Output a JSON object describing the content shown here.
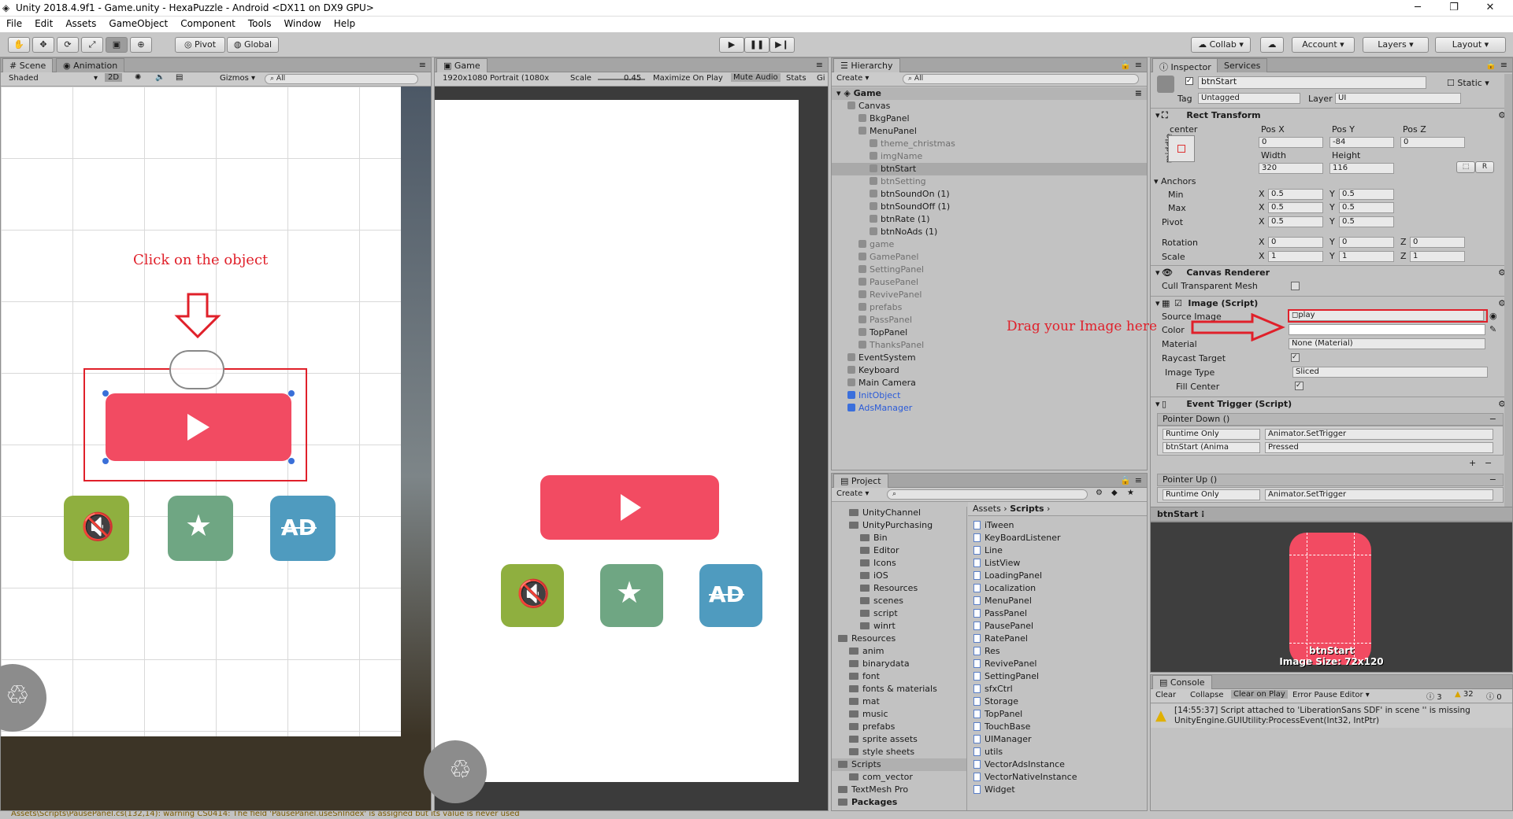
{
  "window": {
    "title": "Unity 2018.4.9f1 - Game.unity - HexaPuzzle - Android <DX11 on DX9 GPU>"
  },
  "menu": [
    "File",
    "Edit",
    "Assets",
    "GameObject",
    "Component",
    "Tools",
    "Window",
    "Help"
  ],
  "toolbar": {
    "pivot": "Pivot",
    "global": "Global",
    "collab": "Collab ▾",
    "account": "Account",
    "layers": "Layers",
    "layout": "Layout"
  },
  "scene": {
    "tab_scene": "Scene",
    "tab_animation": "Animation",
    "shaded": "Shaded",
    "mode_2d": "2D",
    "gizmos": "Gizmos ▾",
    "search": "All",
    "annotation": "Click on the object"
  },
  "game": {
    "tab": "Game",
    "resolution": "1920x1080 Portrait (1080x",
    "scale_label": "Scale",
    "scale_value": "0.45",
    "maximize": "Maximize On Play",
    "mute": "Mute Audio",
    "stats": "Stats",
    "gizmos": "Gi"
  },
  "hierarchy": {
    "tab": "Hierarchy",
    "create": "Create ▾",
    "search": "All",
    "scene": "Game",
    "items": [
      {
        "label": "Canvas",
        "depth": 1,
        "style": "normal"
      },
      {
        "label": "BkgPanel",
        "depth": 2,
        "style": "normal"
      },
      {
        "label": "MenuPanel",
        "depth": 2,
        "style": "normal"
      },
      {
        "label": "theme_christmas",
        "depth": 3,
        "style": "grey"
      },
      {
        "label": "imgName",
        "depth": 3,
        "style": "grey"
      },
      {
        "label": "btnStart",
        "depth": 3,
        "style": "selected"
      },
      {
        "label": "btnSetting",
        "depth": 3,
        "style": "grey"
      },
      {
        "label": "btnSoundOn (1)",
        "depth": 3,
        "style": "normal"
      },
      {
        "label": "btnSoundOff (1)",
        "depth": 3,
        "style": "normal"
      },
      {
        "label": "btnRate (1)",
        "depth": 3,
        "style": "normal"
      },
      {
        "label": "btnNoAds (1)",
        "depth": 3,
        "style": "normal"
      },
      {
        "label": "game",
        "depth": 2,
        "style": "grey"
      },
      {
        "label": "GamePanel",
        "depth": 2,
        "style": "grey"
      },
      {
        "label": "SettingPanel",
        "depth": 2,
        "style": "grey"
      },
      {
        "label": "PausePanel",
        "depth": 2,
        "style": "grey"
      },
      {
        "label": "RevivePanel",
        "depth": 2,
        "style": "grey"
      },
      {
        "label": "prefabs",
        "depth": 2,
        "style": "grey"
      },
      {
        "label": "PassPanel",
        "depth": 2,
        "style": "grey"
      },
      {
        "label": "TopPanel",
        "depth": 2,
        "style": "normal"
      },
      {
        "label": "ThanksPanel",
        "depth": 2,
        "style": "grey"
      },
      {
        "label": "EventSystem",
        "depth": 1,
        "style": "normal"
      },
      {
        "label": "Keyboard",
        "depth": 1,
        "style": "normal"
      },
      {
        "label": "Main Camera",
        "depth": 1,
        "style": "normal"
      },
      {
        "label": "InitObject",
        "depth": 1,
        "style": "blue"
      },
      {
        "label": "AdsManager",
        "depth": 1,
        "style": "blue"
      }
    ]
  },
  "project": {
    "tab": "Project",
    "create": "Create ▾",
    "breadcrumb_root": "Assets",
    "breadcrumb_leaf": "Scripts",
    "folders": [
      {
        "label": "UnityChannel",
        "depth": 1
      },
      {
        "label": "UnityPurchasing",
        "depth": 1
      },
      {
        "label": "Bin",
        "depth": 2
      },
      {
        "label": "Editor",
        "depth": 2
      },
      {
        "label": "Icons",
        "depth": 2
      },
      {
        "label": "iOS",
        "depth": 2
      },
      {
        "label": "Resources",
        "depth": 2
      },
      {
        "label": "scenes",
        "depth": 2
      },
      {
        "label": "script",
        "depth": 2
      },
      {
        "label": "winrt",
        "depth": 2
      },
      {
        "label": "Resources",
        "depth": 0
      },
      {
        "label": "anim",
        "depth": 1
      },
      {
        "label": "binarydata",
        "depth": 1
      },
      {
        "label": "font",
        "depth": 1
      },
      {
        "label": "fonts & materials",
        "depth": 1
      },
      {
        "label": "mat",
        "depth": 1
      },
      {
        "label": "music",
        "depth": 1
      },
      {
        "label": "prefabs",
        "depth": 1
      },
      {
        "label": "sprite assets",
        "depth": 1
      },
      {
        "label": "style sheets",
        "depth": 1
      },
      {
        "label": "Scripts",
        "depth": 0
      },
      {
        "label": "com_vector",
        "depth": 1
      },
      {
        "label": "TextMesh Pro",
        "depth": 0
      },
      {
        "label": "Packages",
        "depth": -1
      }
    ],
    "scripts": [
      "iTween",
      "KeyBoardListener",
      "Line",
      "ListView",
      "LoadingPanel",
      "Localization",
      "MenuPanel",
      "PassPanel",
      "PausePanel",
      "RatePanel",
      "Res",
      "RevivePanel",
      "SettingPanel",
      "sfxCtrl",
      "Storage",
      "TopPanel",
      "TouchBase",
      "UIManager",
      "utils",
      "VectorAdsInstance",
      "VectorNativeInstance",
      "Widget"
    ]
  },
  "inspector": {
    "tab": "Inspector",
    "tab2": "Services",
    "name": "btnStart",
    "static": "Static",
    "tag_label": "Tag",
    "tag": "Untagged",
    "layer_label": "Layer",
    "layer": "UI",
    "rect": {
      "title": "Rect Transform",
      "anchor_h": "center",
      "anchor_v": "middle",
      "posx_l": "Pos X",
      "posy_l": "Pos Y",
      "posz_l": "Pos Z",
      "posx": "0",
      "posy": "-84",
      "posz": "0",
      "width_l": "Width",
      "height_l": "Height",
      "width": "320",
      "height": "116",
      "anchors": "Anchors",
      "min": "Min",
      "max": "Max",
      "pivot": "Pivot",
      "min_x": "0.5",
      "min_y": "0.5",
      "max_x": "0.5",
      "max_y": "0.5",
      "pivot_x": "0.5",
      "pivot_y": "0.5",
      "rotation": "Rotation",
      "rot_x": "0",
      "rot_y": "0",
      "rot_z": "0",
      "scale": "Scale",
      "sc_x": "1",
      "sc_y": "1",
      "sc_z": "1",
      "x": "X",
      "y": "Y",
      "z": "Z",
      "r": "R"
    },
    "canvas_renderer": {
      "title": "Canvas Renderer",
      "cull": "Cull Transparent Mesh"
    },
    "image": {
      "title": "Image (Script)",
      "source_label": "Source Image",
      "source": "play",
      "color_label": "Color",
      "material_label": "Material",
      "material": "None (Material)",
      "raycast": "Raycast Target",
      "image_type_label": "Image Type",
      "image_type": "Sliced",
      "fill_center": "Fill Center"
    },
    "event": {
      "title": "Event Trigger (Script)",
      "pointer_down": "Pointer Down ()",
      "runtime": "Runtime Only",
      "function": "Animator.SetTrigger",
      "object": "btnStart (Anima",
      "arg": "Pressed",
      "pointer_up": "Pointer Up ()"
    },
    "annotation": "Drag your Image here"
  },
  "preview": {
    "title": "btnStart",
    "caption1": "btnStart",
    "caption2": "Image Size: 72x120"
  },
  "console": {
    "tab": "Console",
    "clear": "Clear",
    "collapse": "Collapse",
    "clear_on_play": "Clear on Play",
    "error_pause": "Error Pause",
    "editor": "Editor ▾",
    "count_info": "3",
    "count_warn": "32",
    "count_err": "0",
    "message1": "[14:55:37] Script attached to 'LiberationSans SDF' in scene '' is missing",
    "message2": "UnityEngine.GUIUtility:ProcessEvent(Int32, IntPtr)"
  },
  "status": {
    "message": "Assets\\Scripts\\PausePanel.cs(132,14): warning CS0414: The field 'PausePanel.useSnIndex' is assigned but its value is never used"
  },
  "colors": {
    "play_button": "#f24b62",
    "sound_button": "#8faf3f",
    "star_button": "#6fa683",
    "noads_button": "#4f9bbf",
    "annotation": "#e0202a"
  }
}
